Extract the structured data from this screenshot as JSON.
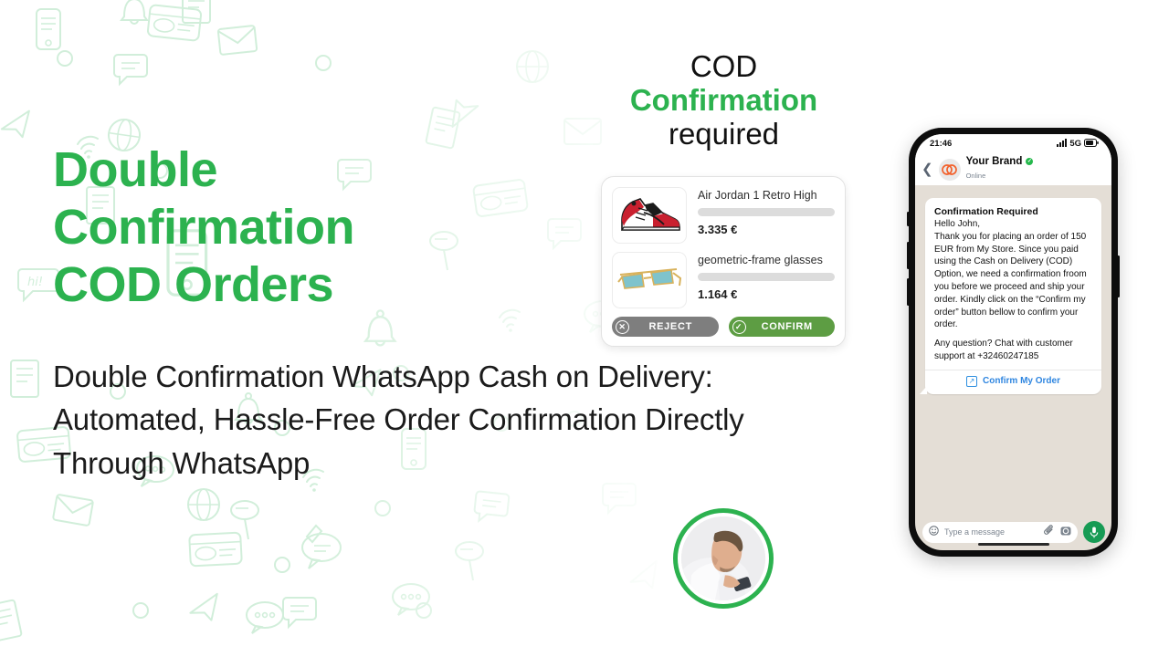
{
  "background": {
    "pattern_name": "chat-doodle-pattern",
    "pattern_color": "#d8f0dd",
    "page_bg": "#ffffff"
  },
  "colors": {
    "brand_green": "#2cb24f",
    "confirm_green": "#5d9d43",
    "reject_gray": "#7e7e7e",
    "link_blue": "#2f86e0",
    "logo_orange": "#f2612c",
    "chat_bg": "#e4ded6",
    "whatsapp_green": "#179b54"
  },
  "hero": {
    "headline": "Double Confirmation COD Orders",
    "subheadline": "Double Confirmation WhatsApp Cash on Delivery: Automated, Hassle-Free Order Confirmation Directly Through WhatsApp"
  },
  "cod_title": {
    "line1": "COD",
    "line2": "Confirmation",
    "line3": "required"
  },
  "product_card": {
    "items": [
      {
        "name": "Air Jordan 1 Retro High",
        "price": "3.335 €",
        "thumb_icon": "sneaker-thumbnail"
      },
      {
        "name": "geometric-frame glasses",
        "price": "1.164 €",
        "thumb_icon": "sunglasses-thumbnail"
      }
    ],
    "reject_label": "REJECT",
    "reject_icon": "x-circle-icon",
    "confirm_label": "CONFIRM",
    "confirm_icon": "check-circle-icon"
  },
  "avatar": {
    "icon_name": "man-using-phone-photo"
  },
  "phone": {
    "status_bar": {
      "time": "21:46",
      "network": "5G",
      "signal_icon": "signal-bars-icon",
      "battery_icon": "battery-icon"
    },
    "chat_header": {
      "back_icon": "chevron-left-icon",
      "logo_icon": "brand-logo-icon",
      "brand_name": "Your Brand",
      "verified_icon": "verified-check-icon",
      "status": "Online"
    },
    "message": {
      "title": "Confirmation Required",
      "body": "Hello John,\nThank you for placing an order of 150 EUR from My Store. Since you paid using the Cash on Delivery (COD) Option, we need a confirmation froom you before we proceed and ship your order. Kindly click on the “Confirm my order” button bellow to confirm your order.",
      "body2": "Any question? Chat with customer support at +32460247185",
      "cta_label": "Confirm My Order",
      "cta_icon": "external-link-icon"
    },
    "input_bar": {
      "emoji_icon": "smiley-icon",
      "placeholder": "Type a message",
      "attach_icon": "paperclip-icon",
      "camera_icon": "camera-icon",
      "mic_icon": "microphone-icon"
    }
  }
}
